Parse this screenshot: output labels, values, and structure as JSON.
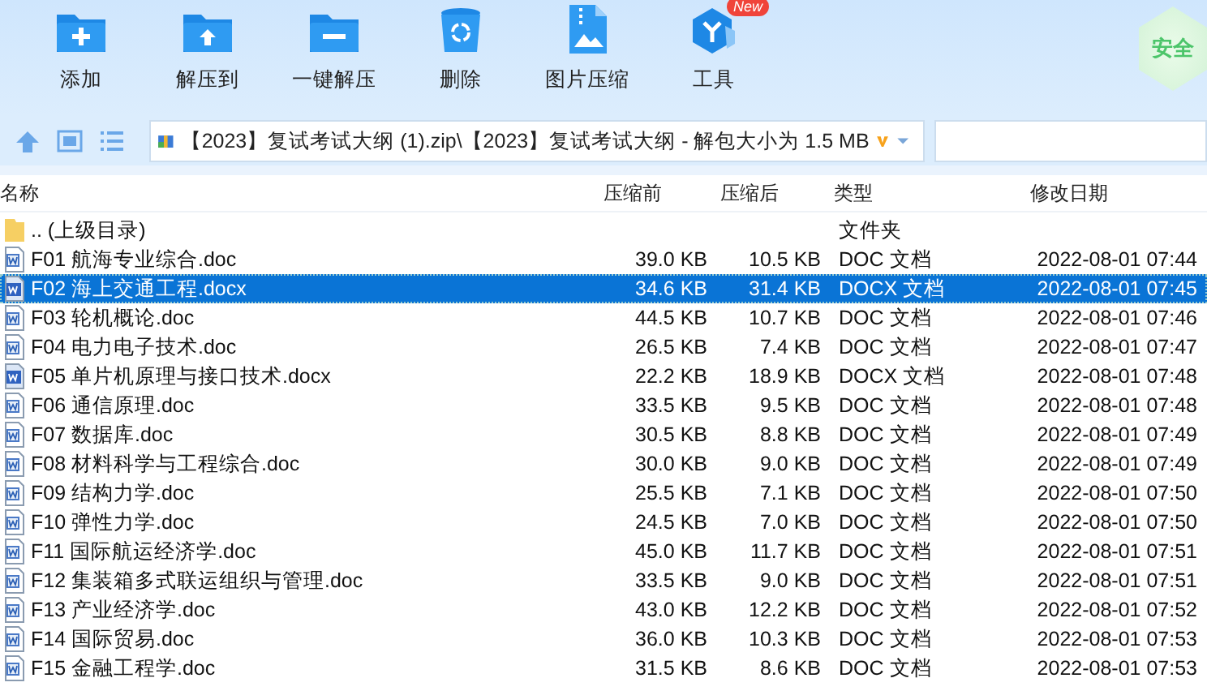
{
  "toolbar": {
    "buttons": [
      {
        "label": "添加",
        "kind": "add"
      },
      {
        "label": "解压到",
        "kind": "extract"
      },
      {
        "label": "一键解压",
        "kind": "oneclick"
      },
      {
        "label": "删除",
        "kind": "delete"
      },
      {
        "label": "图片压缩",
        "kind": "image"
      },
      {
        "label": "工具",
        "kind": "tools",
        "badge": "New"
      }
    ],
    "security_badge": "安全"
  },
  "address_bar": {
    "path": "【2023】复试考试大纲 (1).zip\\【2023】复试考试大纲 - 解包大小为 1.5 MB"
  },
  "table": {
    "columns": [
      "名称",
      "压缩前",
      "压缩后",
      "类型",
      "修改日期"
    ],
    "rows": [
      {
        "kind": "folder",
        "name": ".. (上级目录)",
        "type": "文件夹",
        "selected": false
      },
      {
        "kind": "doc",
        "name": "F01 航海专业综合.doc",
        "size_before": "39.0 KB",
        "size_after": "10.5 KB",
        "type": "DOC 文档",
        "modified": "2022-08-01 07:44",
        "selected": false
      },
      {
        "kind": "docx",
        "name": "F02 海上交通工程.docx",
        "size_before": "34.6 KB",
        "size_after": "31.4 KB",
        "type": "DOCX 文档",
        "modified": "2022-08-01 07:45",
        "selected": true
      },
      {
        "kind": "doc",
        "name": "F03 轮机概论.doc",
        "size_before": "44.5 KB",
        "size_after": "10.7 KB",
        "type": "DOC 文档",
        "modified": "2022-08-01 07:46",
        "selected": false
      },
      {
        "kind": "doc",
        "name": "F04 电力电子技术.doc",
        "size_before": "26.5 KB",
        "size_after": "7.4 KB",
        "type": "DOC 文档",
        "modified": "2022-08-01 07:47",
        "selected": false
      },
      {
        "kind": "docx",
        "name": "F05 单片机原理与接口技术.docx",
        "size_before": "22.2 KB",
        "size_after": "18.9 KB",
        "type": "DOCX 文档",
        "modified": "2022-08-01 07:48",
        "selected": false
      },
      {
        "kind": "doc",
        "name": "F06 通信原理.doc",
        "size_before": "33.5 KB",
        "size_after": "9.5 KB",
        "type": "DOC 文档",
        "modified": "2022-08-01 07:48",
        "selected": false
      },
      {
        "kind": "doc",
        "name": "F07 数据库.doc",
        "size_before": "30.5 KB",
        "size_after": "8.8 KB",
        "type": "DOC 文档",
        "modified": "2022-08-01 07:49",
        "selected": false
      },
      {
        "kind": "doc",
        "name": "F08 材料科学与工程综合.doc",
        "size_before": "30.0 KB",
        "size_after": "9.0 KB",
        "type": "DOC 文档",
        "modified": "2022-08-01 07:49",
        "selected": false
      },
      {
        "kind": "doc",
        "name": "F09 结构力学.doc",
        "size_before": "25.5 KB",
        "size_after": "7.1 KB",
        "type": "DOC 文档",
        "modified": "2022-08-01 07:50",
        "selected": false
      },
      {
        "kind": "doc",
        "name": "F10 弹性力学.doc",
        "size_before": "24.5 KB",
        "size_after": "7.0 KB",
        "type": "DOC 文档",
        "modified": "2022-08-01 07:50",
        "selected": false
      },
      {
        "kind": "doc",
        "name": "F11 国际航运经济学.doc",
        "size_before": "45.0 KB",
        "size_after": "11.7 KB",
        "type": "DOC 文档",
        "modified": "2022-08-01 07:51",
        "selected": false
      },
      {
        "kind": "doc",
        "name": "F12 集装箱多式联运组织与管理.doc",
        "size_before": "33.5 KB",
        "size_after": "9.0 KB",
        "type": "DOC 文档",
        "modified": "2022-08-01 07:51",
        "selected": false
      },
      {
        "kind": "doc",
        "name": "F13 产业经济学.doc",
        "size_before": "43.0 KB",
        "size_after": "12.2 KB",
        "type": "DOC 文档",
        "modified": "2022-08-01 07:52",
        "selected": false
      },
      {
        "kind": "doc",
        "name": "F14 国际贸易.doc",
        "size_before": "36.0 KB",
        "size_after": "10.3 KB",
        "type": "DOC 文档",
        "modified": "2022-08-01 07:53",
        "selected": false
      },
      {
        "kind": "doc",
        "name": "F15 金融工程学.doc",
        "size_before": "31.5 KB",
        "size_after": "8.6 KB",
        "type": "DOC 文档",
        "modified": "2022-08-01 07:53",
        "selected": false
      }
    ]
  }
}
